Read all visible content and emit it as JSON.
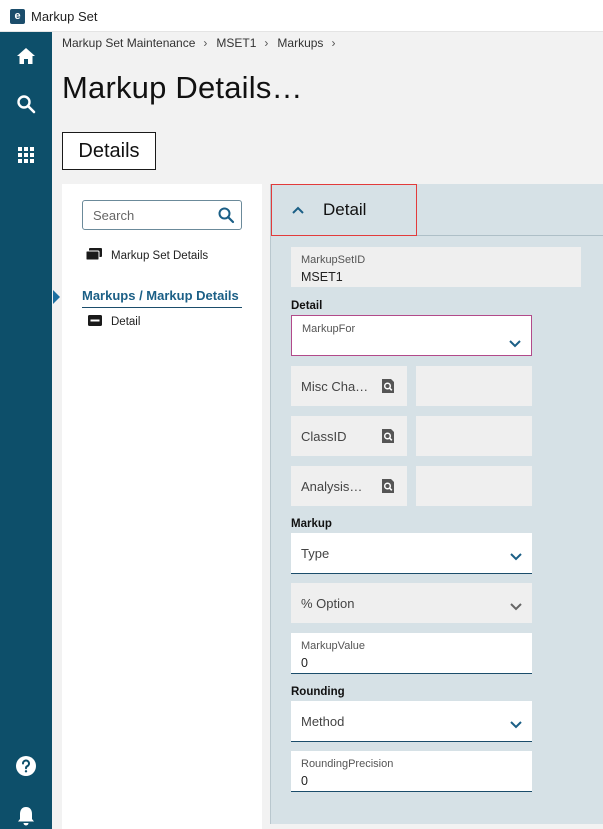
{
  "window": {
    "title": "Markup Set",
    "logo_letter": "e"
  },
  "rail": {
    "items": [
      "home-icon",
      "search-icon",
      "apps-grid-icon",
      "help-icon",
      "notifications-icon"
    ]
  },
  "breadcrumb": [
    "Markup Set Maintenance",
    "MSET1",
    "Markups"
  ],
  "breadcrumb_separator": "›",
  "page_title": "Markup Details…",
  "tab": {
    "label": "Details"
  },
  "nav": {
    "search_placeholder": "Search",
    "item_markup_set_details": "Markup Set Details",
    "group_label": "Markups / Markup Details",
    "item_detail": "Detail"
  },
  "detail": {
    "header": "Detail",
    "markup_set_id": {
      "label": "MarkupSetID",
      "value": "MSET1"
    },
    "section_detail": "Detail",
    "markup_for": {
      "label": "MarkupFor"
    },
    "misc_charge": {
      "label": "Misc Cha…"
    },
    "class_id": {
      "label": "ClassID"
    },
    "analysis": {
      "label": "Analysis…"
    },
    "section_markup": "Markup",
    "type": {
      "label": "Type"
    },
    "pct_option": {
      "label": "% Option"
    },
    "markup_value": {
      "label": "MarkupValue",
      "value": "0"
    },
    "section_rounding": "Rounding",
    "method": {
      "label": "Method"
    },
    "rounding_precision": {
      "label": "RoundingPrecision",
      "value": "0"
    }
  },
  "colors": {
    "rail": "#0d4f6a",
    "accent": "#1b5f86",
    "highlight": "#e23b3b",
    "panel": "#d6e1e6"
  }
}
